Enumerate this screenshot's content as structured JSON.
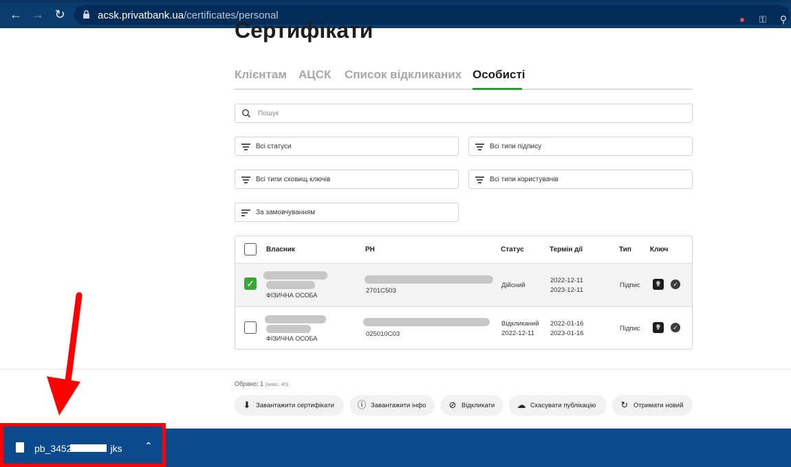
{
  "browser": {
    "url_domain": "acsk.privatbank.ua",
    "url_path": "/certificates/personal"
  },
  "page": {
    "title": "Сертифікати",
    "tabs": [
      {
        "label": "Клієнтам"
      },
      {
        "label": "АЦСК"
      },
      {
        "label": "Список відкликаних"
      },
      {
        "label": "Особисті"
      }
    ],
    "active_tab": "Особисті",
    "search_placeholder": "Пошук",
    "filters": {
      "statuses": "Всі статуси",
      "sign_types": "Всі типи підпису",
      "key_storage": "Всі типи сховищ ключів",
      "user_types": "Всі типи користувачів",
      "sort": "За замовчуванням"
    }
  },
  "table": {
    "headers": {
      "owner": "Власник",
      "rn": "РН",
      "status": "Статус",
      "validity": "Термін дії",
      "type": "Тип",
      "key": "Ключ"
    },
    "rows": [
      {
        "checked": true,
        "owner_type": "ФІЗИЧНА ОСОБА",
        "rn": "2701C503",
        "status": "Дійсний",
        "status_date": "",
        "valid_from": "2022-12-11",
        "valid_to": "2023-12-11",
        "type": "Підпис"
      },
      {
        "checked": false,
        "owner_type": "ФІЗИЧНА ОСОБА",
        "rn": "025010C03",
        "status": "Відкликаний",
        "status_date": "2022-12-11",
        "valid_from": "2022-01-16",
        "valid_to": "2023-01-16",
        "type": "Підпис"
      }
    ]
  },
  "selection": {
    "label": "Обрано: 1",
    "max": "(макс. 40)"
  },
  "actions": {
    "download_certs": "Завантажити сертифікати",
    "download_info": "Завантажити інфо",
    "revoke": "Відкликати",
    "cancel_publication": "Скасувати публікацію",
    "get_new": "Отримати новий"
  },
  "download": {
    "filename": "pb_3452",
    "filename_suffix": "jks"
  },
  "colors": {
    "browser_bar": "#0b3c6e",
    "active_tab_underline": "#2d9a2d",
    "checkbox_checked": "#3aa635",
    "download_bar": "#0b4a8d",
    "highlight_red": "#ff0000"
  }
}
